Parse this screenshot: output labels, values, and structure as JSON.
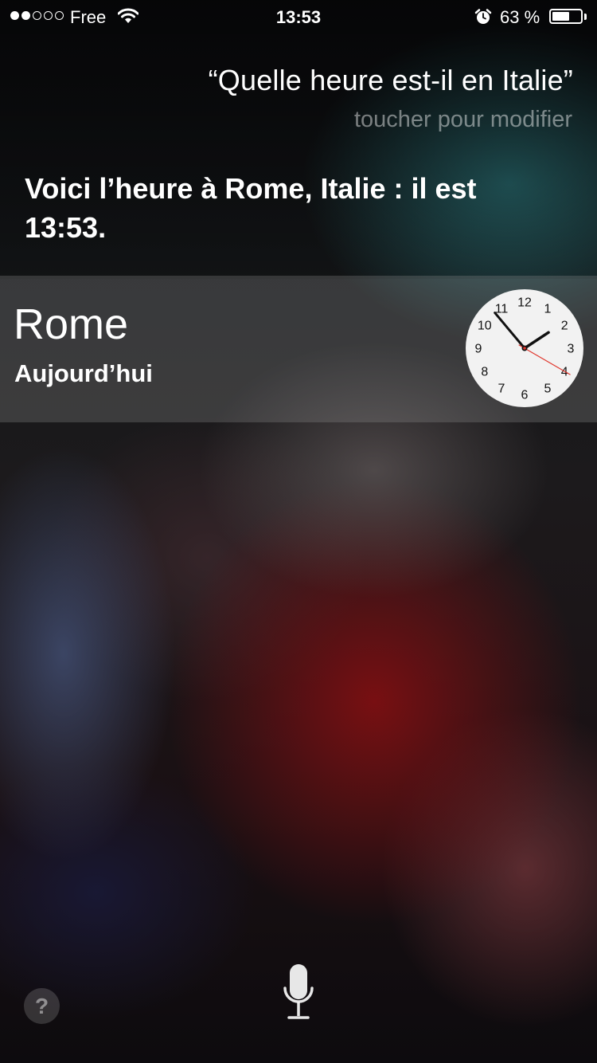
{
  "status_bar": {
    "carrier": "Free",
    "time": "13:53",
    "battery_percent_label": "63 %",
    "battery_level": 0.63,
    "signal_bars_filled": 2,
    "signal_bars_total": 5
  },
  "siri": {
    "query": "“Quelle heure est-il en Italie”",
    "edit_hint": "toucher pour modifier",
    "answer": "Voici l’heure à Rome, Italie : il est 13:53."
  },
  "clock_card": {
    "city": "Rome",
    "day": "Aujourd’hui",
    "time": {
      "hour": 13,
      "minute": 53,
      "second": 20
    },
    "numerals": [
      "12",
      "1",
      "2",
      "3",
      "4",
      "5",
      "6",
      "7",
      "8",
      "9",
      "10",
      "11"
    ]
  },
  "bottom_bar": {
    "help_label": "?"
  },
  "colors": {
    "second_hand": "#e0362c",
    "clock_face": "#f2f2f2",
    "card_background": "rgba(150,150,150,0.28)"
  }
}
